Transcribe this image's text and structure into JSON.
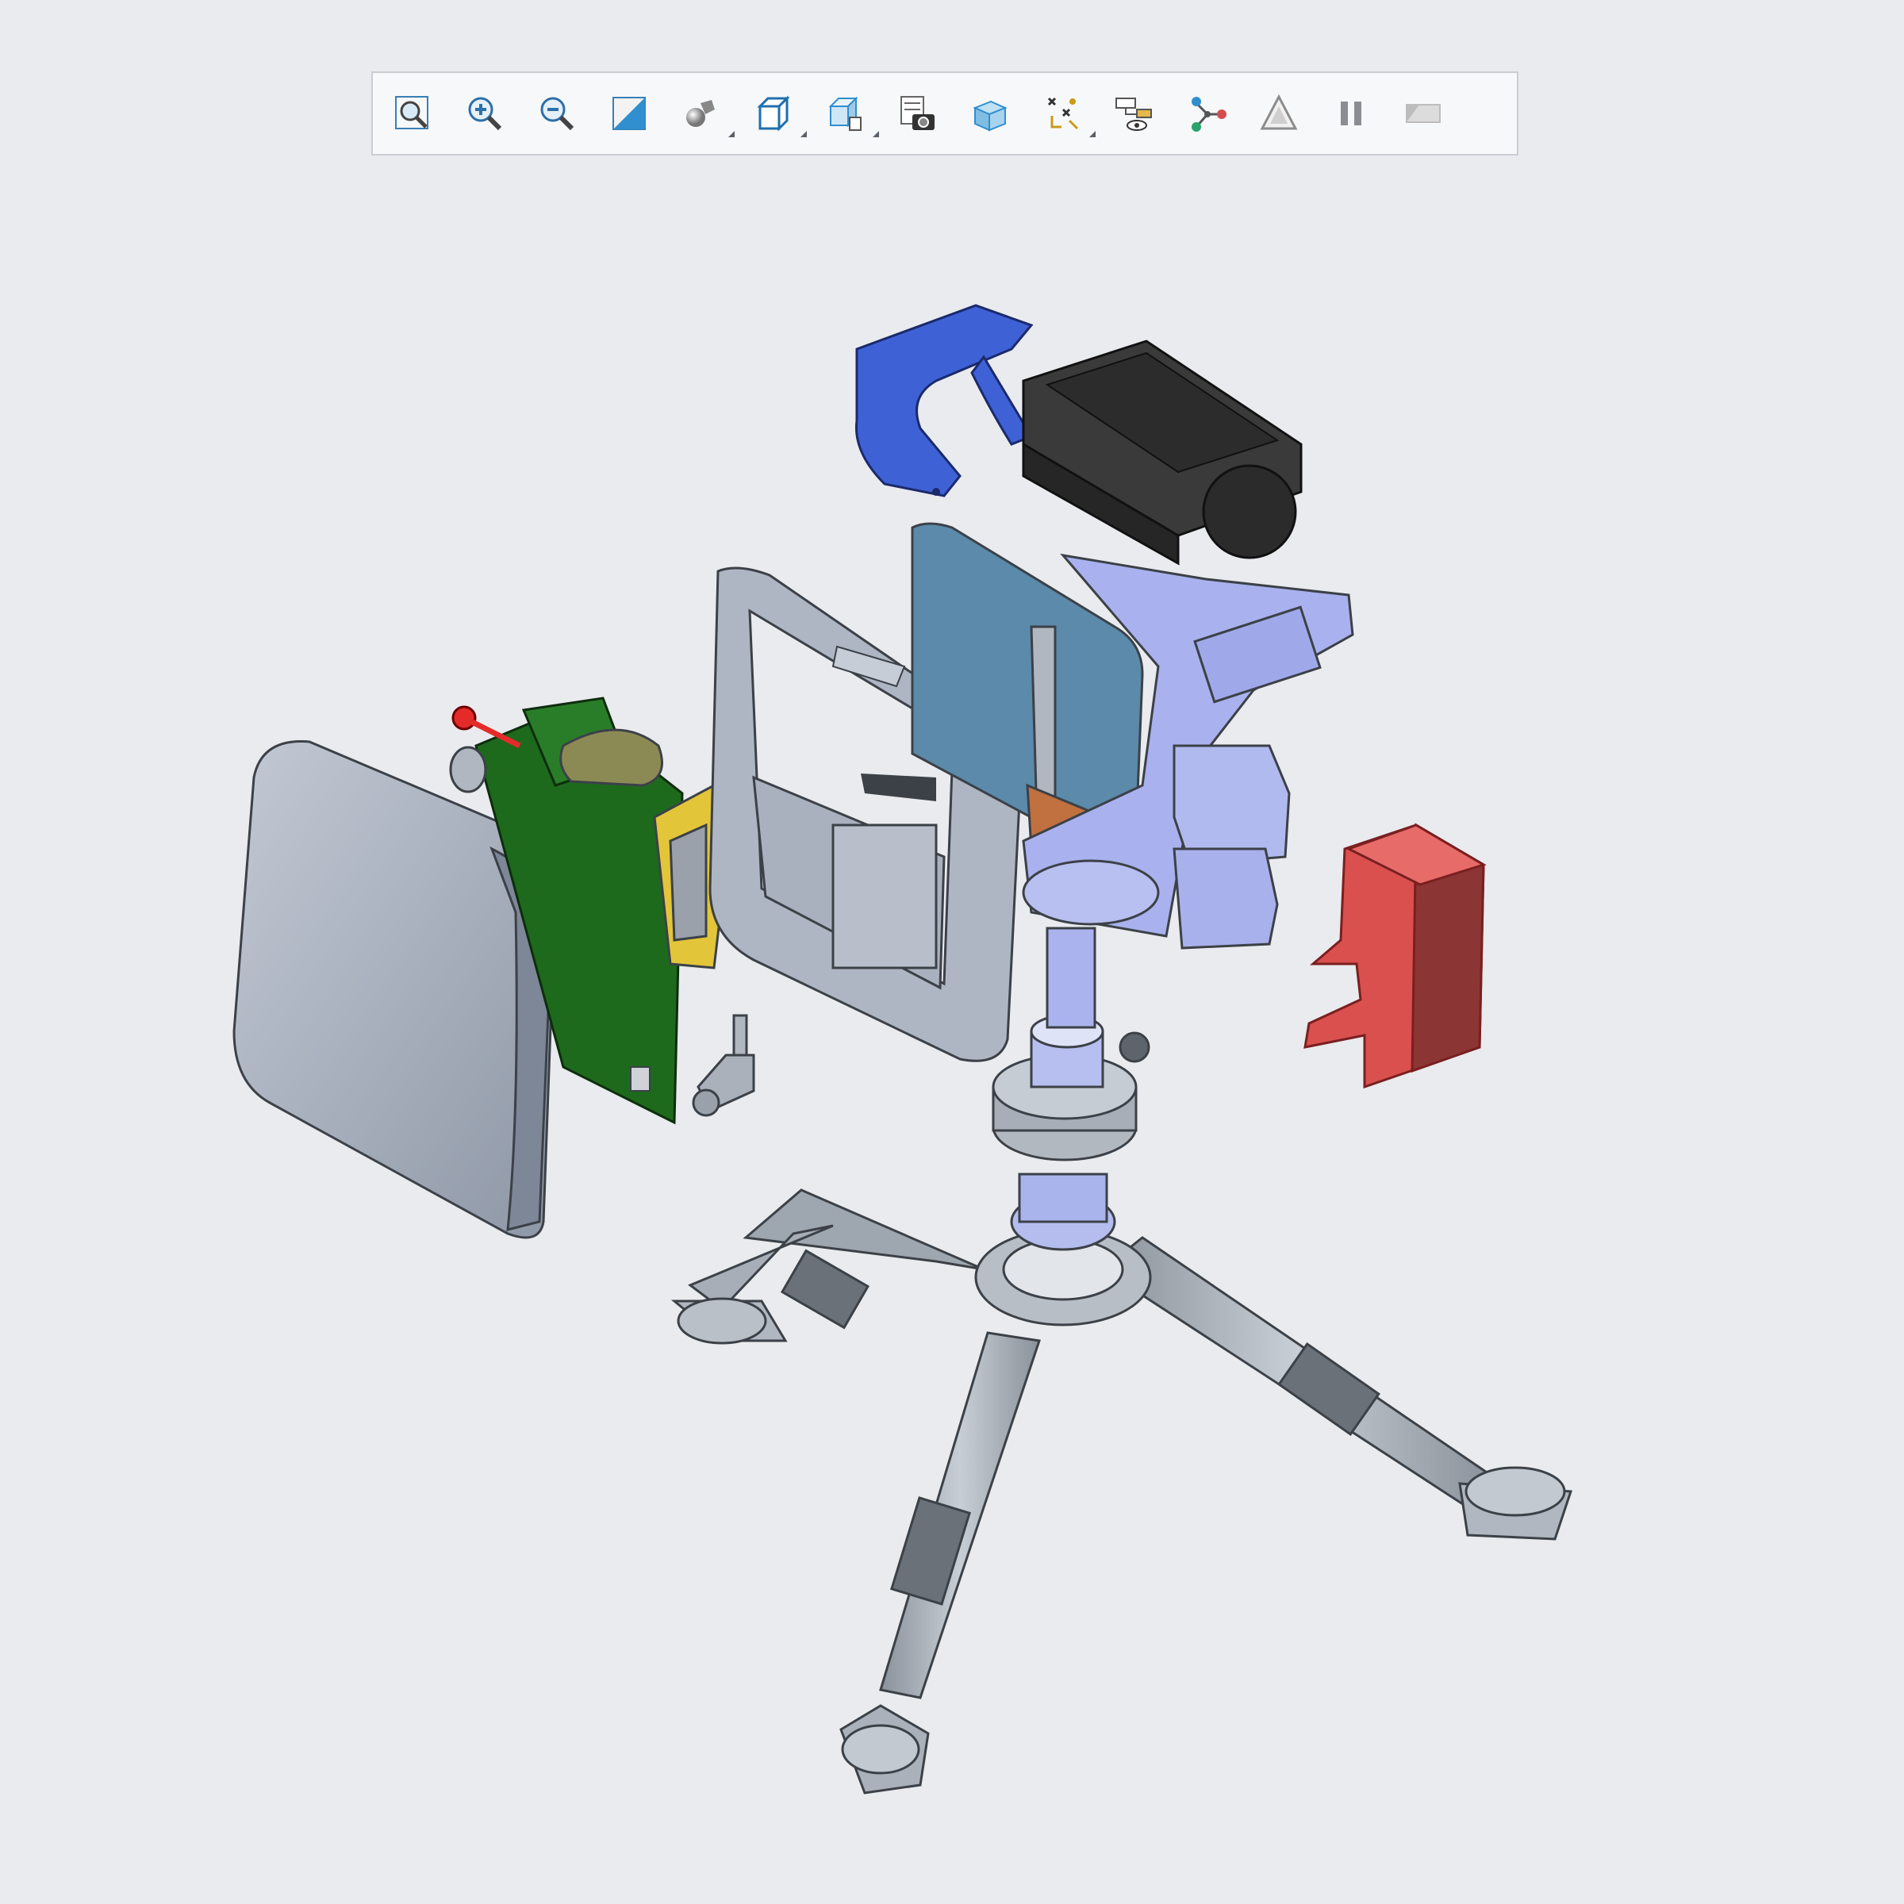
{
  "toolbar": {
    "buttons": [
      {
        "id": "fit-all",
        "icon": "fit-all-icon",
        "caret": false
      },
      {
        "id": "zoom-in",
        "icon": "zoom-in-icon",
        "caret": false
      },
      {
        "id": "zoom-out",
        "icon": "zoom-out-icon",
        "caret": false
      },
      {
        "id": "normal-view",
        "icon": "normal-view-icon",
        "caret": false
      },
      {
        "id": "shading",
        "icon": "shading-icon",
        "caret": true
      },
      {
        "id": "view-orientation",
        "icon": "isometric-cube-icon",
        "caret": true
      },
      {
        "id": "hide-show",
        "icon": "hide-show-icon",
        "caret": true
      },
      {
        "id": "capture",
        "icon": "camera-icon",
        "caret": false
      },
      {
        "id": "render",
        "icon": "render-cube-icon",
        "caret": false
      },
      {
        "id": "explode",
        "icon": "explode-icon",
        "caret": true
      },
      {
        "id": "hide-show-tree",
        "icon": "tree-eye-icon",
        "caret": false
      },
      {
        "id": "network",
        "icon": "network-icon",
        "caret": false
      },
      {
        "id": "warning",
        "icon": "warning-icon",
        "caret": false
      },
      {
        "id": "pause",
        "icon": "pause-icon",
        "caret": false
      },
      {
        "id": "sweep",
        "icon": "sweep-icon",
        "caret": false
      }
    ]
  },
  "colors": {
    "background": "#e9ebee",
    "housing": "#a4adbd",
    "pcb": "#1d6a1c",
    "bracket_blue": "#3f61d6",
    "heatsink": "#3a3a3a",
    "gimbal": "#a9b2ee",
    "panel_blue": "#5b8aaa",
    "red_cover": "#d9504f",
    "tripod": "#a9b0b8",
    "copper": "#c1703f",
    "connector_yellow": "#e3c53a",
    "accent": "#2f8fcf"
  }
}
